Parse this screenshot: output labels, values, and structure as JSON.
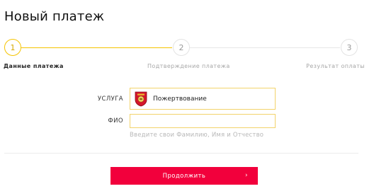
{
  "page": {
    "title": "Новый платеж"
  },
  "steps": [
    {
      "number": "1",
      "label": "Данные платежа",
      "active": true
    },
    {
      "number": "2",
      "label": "Подтверждение платежа",
      "active": false
    },
    {
      "number": "3",
      "label": "Результат оплаты",
      "active": false
    }
  ],
  "form": {
    "service_label": "УСЛУГА",
    "service_value": "Пожертвование",
    "service_icon": "coat-of-arms-icon",
    "fio_label": "ФИО",
    "fio_value": "",
    "fio_hint": "Введите свои Фамилию, Имя и Отчество"
  },
  "actions": {
    "continue_label": "Продолжить",
    "continue_arrow": "›"
  },
  "colors": {
    "accent": "#f5c400",
    "button": "#f2003c",
    "border": "#f3d36b"
  }
}
